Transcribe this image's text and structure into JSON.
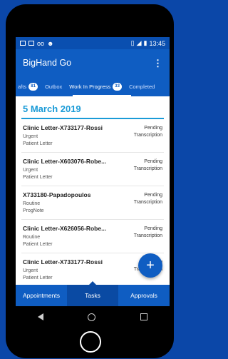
{
  "status": {
    "time": "13:45"
  },
  "appbar": {
    "title": "BigHand Go",
    "menu_icon": "⋮"
  },
  "tabs": [
    {
      "label": "afts",
      "badge": "81"
    },
    {
      "label": "Outbox",
      "badge": ""
    },
    {
      "label": "Work In Progress",
      "badge": "33"
    },
    {
      "label": "Completed",
      "badge": ""
    }
  ],
  "date_header": "5 March 2019",
  "rows": [
    {
      "title": "Clinic Letter-X733177-Rossi",
      "priority": "Urgent",
      "type": "Patient Letter",
      "status": "Pending",
      "stage": "Transcription"
    },
    {
      "title": "Clinic Letter-X603076-Robe...",
      "priority": "Urgent",
      "type": "Patient Letter",
      "status": "Pending",
      "stage": "Transcription"
    },
    {
      "title": "X733180-Papadopoulos",
      "priority": "Routine",
      "type": "ProgNote",
      "status": "Pending",
      "stage": "Transcription"
    },
    {
      "title": "Clinic Letter-X626056-Robe...",
      "priority": "Routine",
      "type": "Patient Letter",
      "status": "Pending",
      "stage": "Transcription"
    },
    {
      "title": "Clinic Letter-X733177-Rossi",
      "priority": "Urgent",
      "type": "Patient Letter",
      "status": "Pending",
      "stage": "Transcription"
    }
  ],
  "fab": "+",
  "bottomnav": {
    "appointments": "Appointments",
    "tasks": "Tasks",
    "approvals": "Approvals"
  },
  "colors": {
    "primary": "#0f5dc2",
    "accent": "#1a9bd7",
    "background": "#0b47a8"
  }
}
